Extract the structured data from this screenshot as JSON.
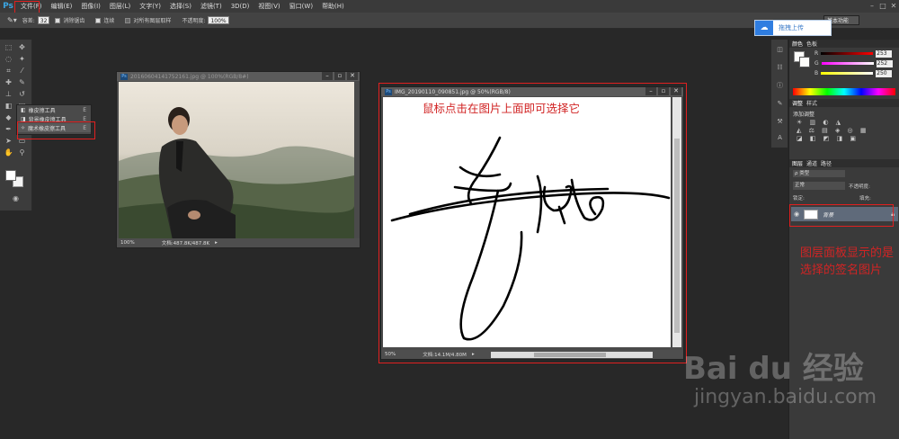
{
  "app": {
    "logo": "Ps"
  },
  "menu": [
    "文件(F)",
    "编辑(E)",
    "图像(I)",
    "图层(L)",
    "文字(Y)",
    "选择(S)",
    "滤镜(T)",
    "3D(D)",
    "视图(V)",
    "窗口(W)",
    "帮助(H)"
  ],
  "options": {
    "tolerance_label": "容差:",
    "tolerance_value": "32",
    "antialias": "消除锯齿",
    "contiguous": "连续",
    "sample_all": "对所有图层取样",
    "opacity_label": "不透明度:",
    "opacity_value": "100%"
  },
  "workspace": "基本功能",
  "cloud_upload": "拖拽上传",
  "flyout": [
    {
      "label": "橡皮擦工具",
      "key": "E"
    },
    {
      "label": "背景橡皮擦工具",
      "key": "E"
    },
    {
      "label": "魔术橡皮擦工具",
      "key": "E"
    }
  ],
  "doc1": {
    "title": "20160604141752161.jpg @ 100%(RGB/8#)",
    "zoom": "100%",
    "status": "文档:487.8K/487.8K"
  },
  "doc2": {
    "title": "IMG_20190110_090851.jpg @ 50%(RGB/8)",
    "zoom": "50%",
    "status": "文档:14.1M/4.80M"
  },
  "color_panel": {
    "tabs": [
      "颜色",
      "色板"
    ],
    "r": "253",
    "g": "252",
    "b": "250",
    "r_label": "R",
    "g_label": "G",
    "b_label": "B"
  },
  "adjust_panel": {
    "tabs": [
      "调整",
      "样式"
    ],
    "add_label": "添加调整"
  },
  "layers_panel": {
    "tabs": [
      "图层",
      "通道",
      "路径"
    ],
    "kind": "ρ 类型",
    "blend": "正常",
    "opacity_label": "不透明度:",
    "lock_label": "锁定:",
    "fill_label": "填充:",
    "layer_name": "背景"
  },
  "annotations": {
    "doc_hint": "鼠标点击在图片上面即可选择它",
    "layers_hint": "图层面板显示的是选择的签名图片"
  },
  "watermark": {
    "brand": "Bai du 经验",
    "url": "jingyan.baidu.com"
  },
  "colors": {
    "accent_red": "#e02020",
    "ps_blue": "#3ba6e3",
    "bg": "#282828"
  }
}
